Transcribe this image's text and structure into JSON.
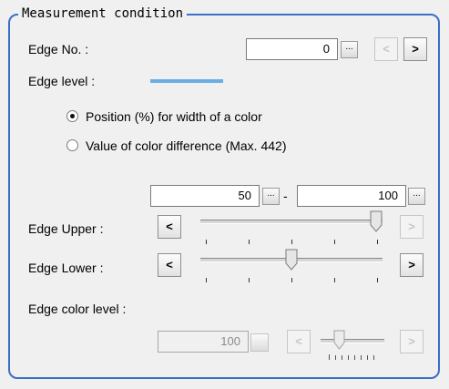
{
  "group": {
    "title": "Measurement condition"
  },
  "edge_no": {
    "label": "Edge No. :",
    "value": "0",
    "browse": "...",
    "prev": "<",
    "next": ">"
  },
  "edge_level": {
    "label": "Edge level :",
    "color": "#6aaee4"
  },
  "radios": [
    {
      "label": "Position (%) for width of a color",
      "checked": true
    },
    {
      "label": "Value of color difference (Max. 442)",
      "checked": false
    }
  ],
  "range": {
    "lower_value": "50",
    "browse": "...",
    "separator": "-",
    "upper_value": "100"
  },
  "edge_upper": {
    "label": "Edge Upper :",
    "dec": "<",
    "inc": ">",
    "level_percent": 100
  },
  "edge_lower": {
    "label": "Edge Lower :",
    "dec": "<",
    "inc": ">",
    "level_percent": 50
  },
  "edge_color_level": {
    "label": "Edge color level :",
    "value": "100",
    "browse": "...",
    "dec": "<",
    "inc": ">"
  }
}
